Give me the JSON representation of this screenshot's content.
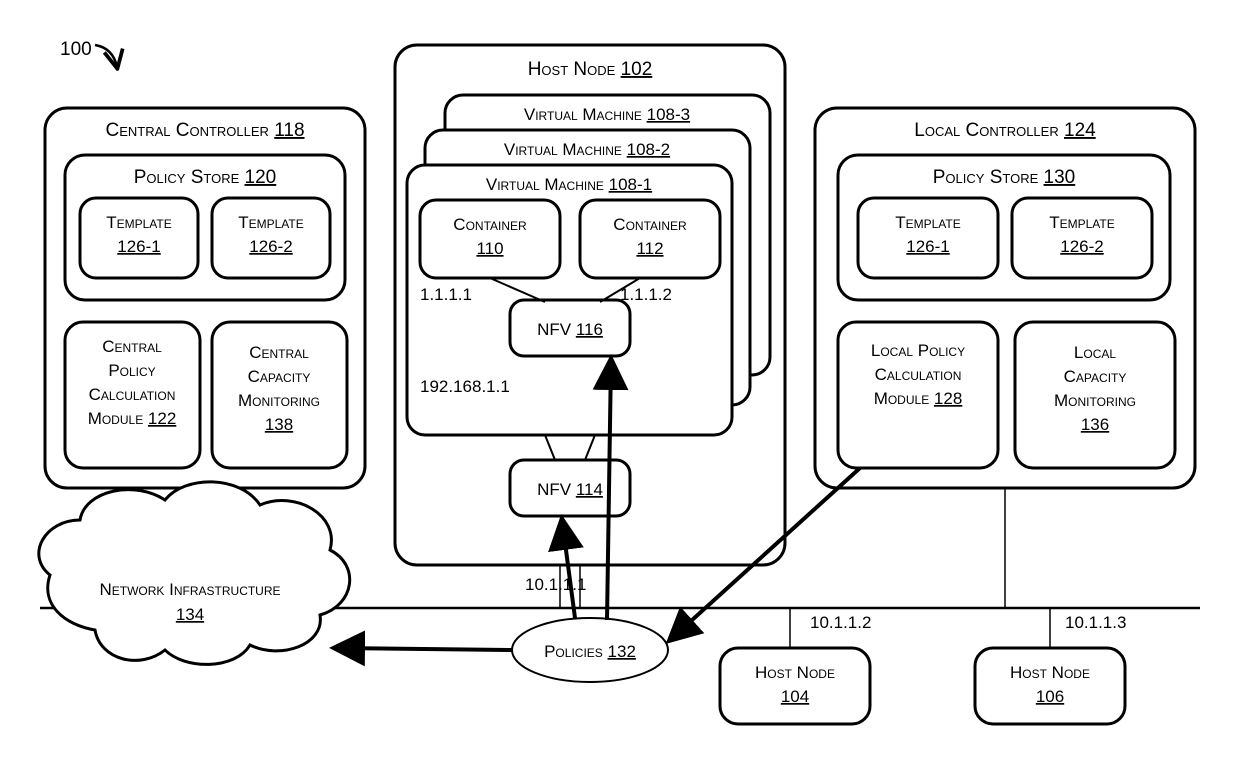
{
  "figure_ref": "100",
  "central_controller": {
    "title": "Central Controller",
    "ref": "118",
    "policy_store": {
      "title": "Policy Store",
      "ref": "120"
    },
    "template_a": {
      "title": "Template",
      "ref": "126-1"
    },
    "template_b": {
      "title": "Template",
      "ref": "126-2"
    },
    "policy_calc": {
      "title": "Central Policy Calculation Module",
      "ref": "122"
    },
    "capacity_mon": {
      "title": "Central Capacity Monitoring",
      "ref": "138"
    }
  },
  "host_node_main": {
    "title": "Host Node",
    "ref": "102",
    "vm1": {
      "title": "Virtual Machine",
      "ref": "108-1"
    },
    "vm2": {
      "title": "Virtual Machine",
      "ref": "108-2"
    },
    "vm3": {
      "title": "Virtual Machine",
      "ref": "108-3"
    },
    "container_a": {
      "title": "Container",
      "ref": "110"
    },
    "container_b": {
      "title": "Container",
      "ref": "112"
    },
    "ip_container_a": "1.1.1.1",
    "ip_container_b": "1.1.1.2",
    "nfv_inner": {
      "title": "NFV",
      "ref": "116"
    },
    "vm_ip": "192.168.1.1",
    "nfv_outer": {
      "title": "NFV",
      "ref": "114"
    },
    "host_ip": "10.1.1.1"
  },
  "local_controller": {
    "title": "Local Controller",
    "ref": "124",
    "policy_store": {
      "title": "Policy Store",
      "ref": "130"
    },
    "template_a": {
      "title": "Template",
      "ref": "126-1"
    },
    "template_b": {
      "title": "Template",
      "ref": "126-2"
    },
    "policy_calc": {
      "title": "Local Policy Calculation Module",
      "ref": "128"
    },
    "capacity_mon": {
      "title": "Local Capacity Monitoring",
      "ref": "136"
    }
  },
  "network_infra": {
    "title": "Network Infrastructure",
    "ref": "134"
  },
  "policies": {
    "title": "Policies",
    "ref": "132"
  },
  "host_node_2": {
    "title": "Host Node",
    "ref": "104",
    "ip": "10.1.1.2"
  },
  "host_node_3": {
    "title": "Host Node",
    "ref": "106",
    "ip": "10.1.1.3"
  }
}
